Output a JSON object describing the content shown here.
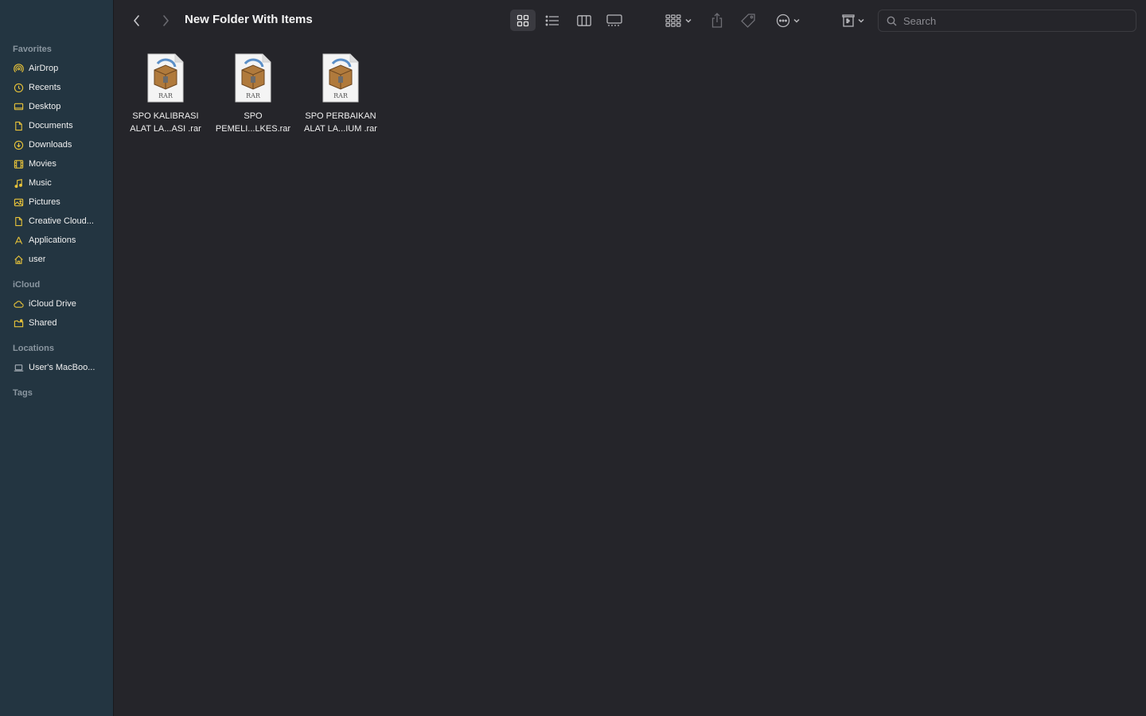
{
  "window": {
    "title": "New Folder With Items"
  },
  "sidebar": {
    "favorites_title": "Favorites",
    "favorites": [
      {
        "label": "AirDrop",
        "icon": "airdrop-icon"
      },
      {
        "label": "Recents",
        "icon": "clock-icon"
      },
      {
        "label": "Desktop",
        "icon": "desktop-icon"
      },
      {
        "label": "Documents",
        "icon": "document-icon"
      },
      {
        "label": "Downloads",
        "icon": "download-icon"
      },
      {
        "label": "Movies",
        "icon": "film-icon"
      },
      {
        "label": "Music",
        "icon": "music-note-icon"
      },
      {
        "label": "Pictures",
        "icon": "photo-icon"
      },
      {
        "label": "Creative Cloud...",
        "icon": "file-icon"
      },
      {
        "label": "Applications",
        "icon": "applications-icon"
      },
      {
        "label": "user",
        "icon": "home-icon"
      }
    ],
    "icloud_title": "iCloud",
    "icloud": [
      {
        "label": "iCloud Drive",
        "icon": "cloud-icon"
      },
      {
        "label": "Shared",
        "icon": "shared-folder-icon"
      }
    ],
    "locations_title": "Locations",
    "locations": [
      {
        "label": "User's MacBoo...",
        "icon": "laptop-icon"
      }
    ],
    "tags_title": "Tags"
  },
  "toolbar": {
    "search_placeholder": "Search",
    "accent": "#b8b8bc"
  },
  "files": [
    {
      "line1": "SPO KALIBRASI",
      "line2": "ALAT LA...ASI .rar",
      "badge": "RAR"
    },
    {
      "line1": "SPO",
      "line2": "PEMELI...LKES.rar",
      "badge": "RAR"
    },
    {
      "line1": "SPO PERBAIKAN",
      "line2": "ALAT LA...IUM .rar",
      "badge": "RAR"
    }
  ],
  "colors": {
    "sidebar_bg": "#233541",
    "content_bg": "#25252a",
    "icon_yellow": "#e8c33a"
  }
}
